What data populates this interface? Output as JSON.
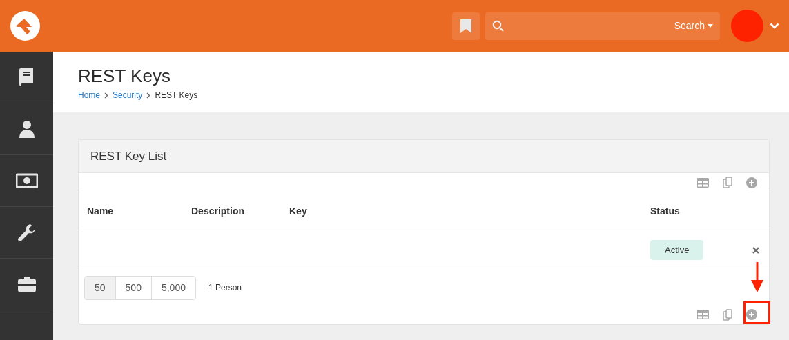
{
  "header": {
    "search": {
      "label": "Search"
    }
  },
  "page": {
    "title": "REST Keys",
    "breadcrumb": [
      {
        "label": "Home",
        "link": true
      },
      {
        "label": "Security",
        "link": true
      },
      {
        "label": "REST Keys",
        "link": false
      }
    ]
  },
  "card": {
    "title": "REST Key List",
    "columns": [
      "Name",
      "Description",
      "Key",
      "Status"
    ],
    "rows": [
      {
        "status": "Active"
      }
    ],
    "pager": {
      "sizes": [
        {
          "label": "50",
          "selected": true
        },
        {
          "label": "500",
          "selected": false
        },
        {
          "label": "5,000",
          "selected": false
        }
      ],
      "count": "1 Person"
    }
  }
}
